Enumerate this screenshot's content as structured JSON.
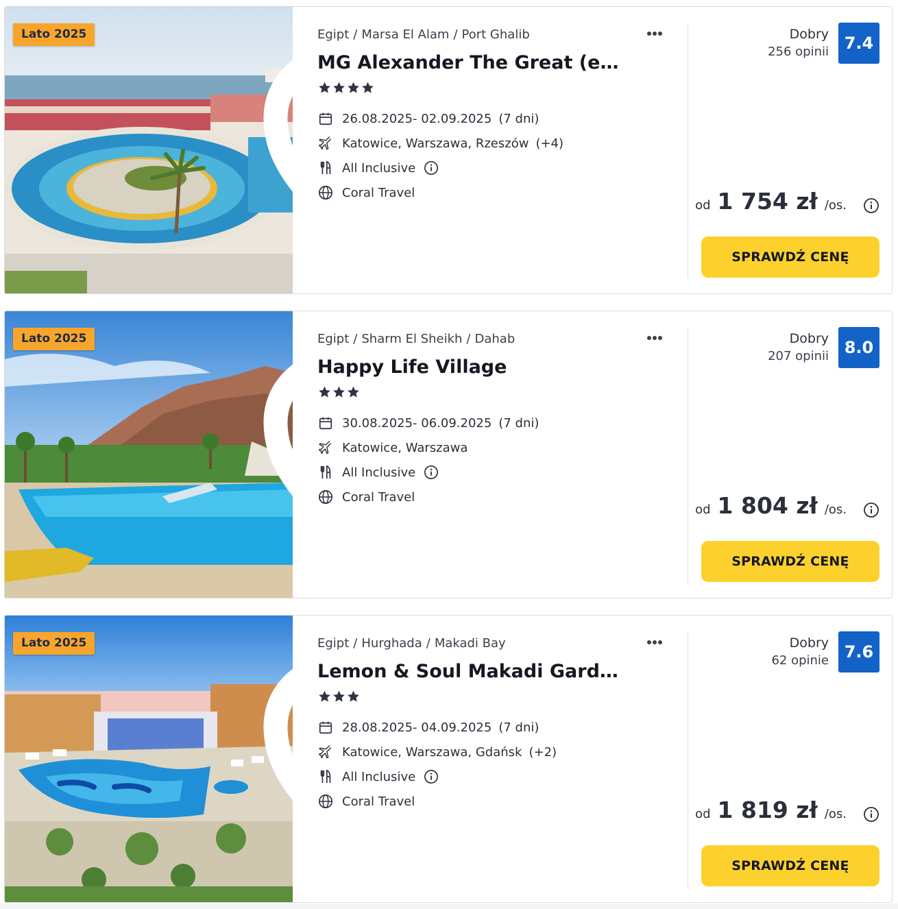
{
  "offers": [
    {
      "badge": "Lato 2025",
      "country": "Egipt",
      "region": "Marsa El Alam",
      "city": "Port Ghalib",
      "title": "MG Alexander The Great (ex. D...",
      "stars": 4,
      "dates": "26.08.2025- 02.09.2025",
      "duration": "(7 dni)",
      "airports": "Katowice, Warszawa, Rzeszów",
      "airports_more": "(+4)",
      "board": "All Inclusive",
      "operator": "Coral Travel",
      "rating_label": "Dobry",
      "rating_count": "256 opinii",
      "rating_score": "7.4",
      "price_prefix": "od",
      "price": "1 754 zł",
      "price_suffix": "/os.",
      "cta": "SPRAWDŹ CENĘ",
      "photo": "resort-circular-pool"
    },
    {
      "badge": "Lato 2025",
      "country": "Egipt",
      "region": "Sharm El Sheikh",
      "city": "Dahab",
      "title": "Happy Life Village",
      "stars": 3,
      "dates": "30.08.2025- 06.09.2025",
      "duration": "(7 dni)",
      "airports": "Katowice, Warszawa",
      "airports_more": "",
      "board": "All Inclusive",
      "operator": "Coral Travel",
      "rating_label": "Dobry",
      "rating_count": "207 opinii",
      "rating_score": "8.0",
      "price_prefix": "od",
      "price": "1 804 zł",
      "price_suffix": "/os.",
      "cta": "SPRAWDŹ CENĘ",
      "photo": "pool-mountains"
    },
    {
      "badge": "Lato 2025",
      "country": "Egipt",
      "region": "Hurghada",
      "city": "Makadi Bay",
      "title": "Lemon & Soul Makadi Garden (...",
      "stars": 3,
      "dates": "28.08.2025- 04.09.2025",
      "duration": "(7 dni)",
      "airports": "Katowice, Warszawa, Gdańsk",
      "airports_more": "(+2)",
      "board": "All Inclusive",
      "operator": "Coral Travel",
      "rating_label": "Dobry",
      "rating_count": "62 opinie",
      "rating_score": "7.6",
      "price_prefix": "od",
      "price": "1 819 zł",
      "price_suffix": "/os.",
      "cta": "SPRAWDŹ CENĘ",
      "photo": "resort-aerial-garden"
    }
  ],
  "icons": {
    "favorite": "heart-outline-icon",
    "more": "more-dots-icon",
    "star": "star-icon",
    "calendar": "calendar-icon",
    "flight": "airplane-icon",
    "board": "cutlery-icon",
    "operator": "globe-icon",
    "info": "info-icon"
  },
  "colors": {
    "badge": "#f8a52b",
    "rating": "#1262c8",
    "cta": "#fdd12d",
    "text": "#2a2f3a"
  }
}
